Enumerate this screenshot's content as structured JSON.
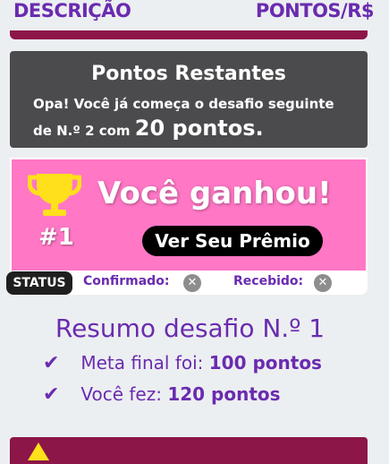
{
  "header": {
    "left": "DESCRIÇÃO",
    "right": "PONTOS/R$"
  },
  "restantes": {
    "title": "Pontos Restantes",
    "line1": "Opa! Você já começa o desafio seguinte",
    "line2_prefix": "de N.º 2 com",
    "line2_points": "20 pontos."
  },
  "win": {
    "rank": "#1",
    "title": "Você ganhou!",
    "button": "Ver Seu Prêmio",
    "bg_color": "#ff77c5"
  },
  "status": {
    "label": "STATUS",
    "confirmed_label": "Confirmado:",
    "received_label": "Recebido:",
    "confirmed_icon": "✕",
    "received_icon": "✕"
  },
  "summary": {
    "title": "Resumo desafio N.º 1",
    "goal_label": "Meta final foi:",
    "goal_value": "100 pontos",
    "made_label": "Você fez:",
    "made_value": "120 pontos"
  },
  "colors": {
    "accent": "#6a2bb0",
    "brand_dark": "#8c1648",
    "card": "#4b4b4e"
  }
}
